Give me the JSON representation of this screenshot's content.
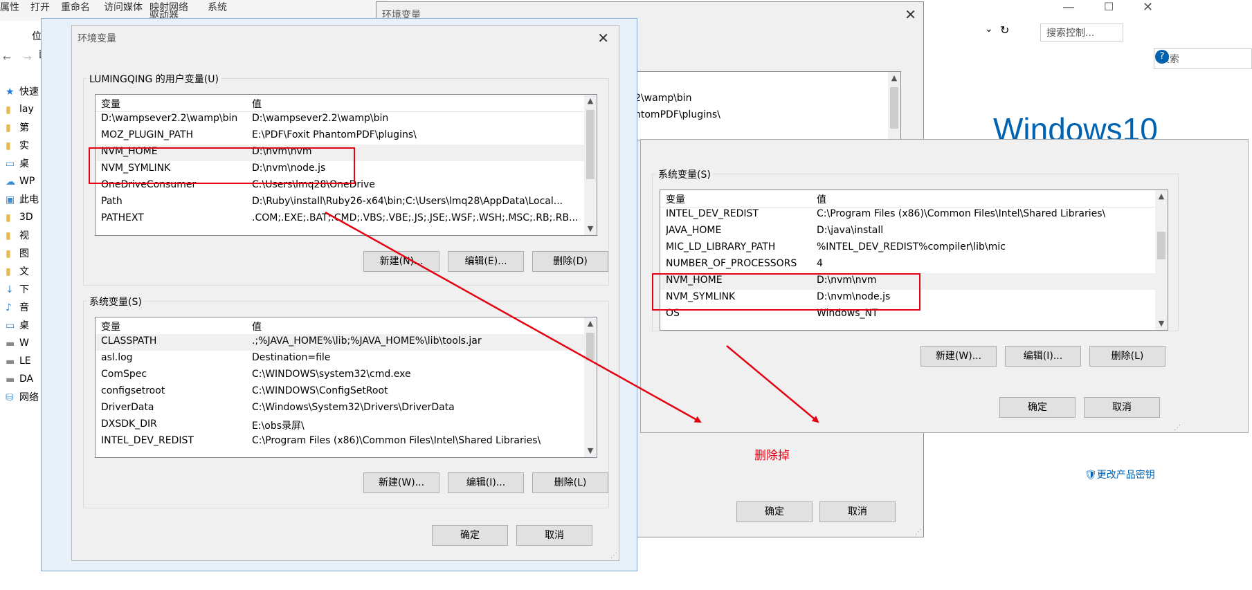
{
  "explorer": {
    "ribbon": [
      "属性",
      "打开",
      "重命名",
      "访问媒体",
      "映射网络",
      "驱动器",
      "系统"
    ],
    "location_label": "位",
    "address_tail": "面板",
    "nav_items": [
      {
        "icon": "star-icon",
        "label": "快速"
      },
      {
        "icon": "folder-icon",
        "label": "lay"
      },
      {
        "icon": "folder-icon",
        "label": "第"
      },
      {
        "icon": "folder-icon",
        "label": "实"
      },
      {
        "icon": "desktop-icon",
        "label": "桌"
      },
      {
        "icon": "cloud-icon",
        "label": "WP"
      },
      {
        "icon": "pc-icon",
        "label": "此电"
      },
      {
        "icon": "folder-icon",
        "label": "3D"
      },
      {
        "icon": "folder-icon",
        "label": "视"
      },
      {
        "icon": "folder-icon",
        "label": "图"
      },
      {
        "icon": "folder-icon",
        "label": "文"
      },
      {
        "icon": "download-icon",
        "label": "下"
      },
      {
        "icon": "music-icon",
        "label": "音"
      },
      {
        "icon": "desktop-icon",
        "label": "桌"
      },
      {
        "icon": "drive-icon",
        "label": "W"
      },
      {
        "icon": "drive-icon",
        "label": "LE"
      },
      {
        "icon": "drive-icon",
        "label": "DA"
      },
      {
        "icon": "network-icon",
        "label": "网络"
      }
    ]
  },
  "back_window": {
    "title": "环境变量",
    "fragments": [
      "2\\wamp\\bin",
      "ntomPDF\\plugins\\"
    ],
    "ok": "确定",
    "cancel": "取消"
  },
  "system_panel": {
    "search_placeholder": "搜索控制...",
    "search_placeholder_2": "搜索",
    "windows_logo": "Windows10",
    "product_key_link": "更改产品密钥"
  },
  "main_dialog": {
    "title": "环境变量",
    "user_group_label": "LUMINGQING 的用户变量(U)",
    "col_var": "变量",
    "col_val": "值",
    "user_rows": [
      {
        "var": "D:\\wampsever2.2\\wamp\\bin",
        "val": "D:\\wampsever2.2\\wamp\\bin"
      },
      {
        "var": "MOZ_PLUGIN_PATH",
        "val": "E:\\PDF\\Foxit PhantomPDF\\plugins\\"
      },
      {
        "var": "NVM_HOME",
        "val": "D:\\nvm\\nvm"
      },
      {
        "var": "NVM_SYMLINK",
        "val": "D:\\nvm\\node.js"
      },
      {
        "var": "OneDriveConsumer",
        "val": "C:\\Users\\lmq28\\OneDrive"
      },
      {
        "var": "Path",
        "val": "D:\\Ruby\\install\\Ruby26-x64\\bin;C:\\Users\\lmq28\\AppData\\Local..."
      },
      {
        "var": "PATHEXT",
        "val": ".COM;.EXE;.BAT;.CMD;.VBS;.VBE;.JS;.JSE;.WSF;.WSH;.MSC;.RB;.RB..."
      }
    ],
    "user_new": "新建(N)...",
    "user_edit": "编辑(E)...",
    "user_delete": "删除(D)",
    "sys_group_label": "系统变量(S)",
    "sys_rows": [
      {
        "var": "CLASSPATH",
        "val": ".;%JAVA_HOME%\\lib;%JAVA_HOME%\\lib\\tools.jar"
      },
      {
        "var": "asl.log",
        "val": "Destination=file"
      },
      {
        "var": "ComSpec",
        "val": "C:\\WINDOWS\\system32\\cmd.exe"
      },
      {
        "var": "configsetroot",
        "val": "C:\\WINDOWS\\ConfigSetRoot"
      },
      {
        "var": "DriverData",
        "val": "C:\\Windows\\System32\\Drivers\\DriverData"
      },
      {
        "var": "DXSDK_DIR",
        "val": "E:\\obs录屏\\"
      },
      {
        "var": "INTEL_DEV_REDIST",
        "val": "C:\\Program Files (x86)\\Common Files\\Intel\\Shared Libraries\\"
      }
    ],
    "sys_new": "新建(W)...",
    "sys_edit": "编辑(I)...",
    "sys_delete": "删除(L)",
    "ok": "确定",
    "cancel": "取消"
  },
  "right_dialog": {
    "sys_group_label": "系统变量(S)",
    "col_var": "变量",
    "col_val": "值",
    "rows": [
      {
        "var": "INTEL_DEV_REDIST",
        "val": "C:\\Program Files (x86)\\Common Files\\Intel\\Shared Libraries\\"
      },
      {
        "var": "JAVA_HOME",
        "val": "D:\\java\\install"
      },
      {
        "var": "MIC_LD_LIBRARY_PATH",
        "val": "%INTEL_DEV_REDIST%compiler\\lib\\mic"
      },
      {
        "var": "NUMBER_OF_PROCESSORS",
        "val": "4"
      },
      {
        "var": "NVM_HOME",
        "val": "D:\\nvm\\nvm"
      },
      {
        "var": "NVM_SYMLINK",
        "val": "D:\\nvm\\node.js"
      },
      {
        "var": "OS",
        "val": "Windows_NT"
      }
    ],
    "new": "新建(W)...",
    "edit": "编辑(I)...",
    "delete": "删除(L)",
    "ok": "确定",
    "cancel": "取消"
  },
  "annotation": {
    "text": "删除掉",
    "color": "#e60012"
  }
}
